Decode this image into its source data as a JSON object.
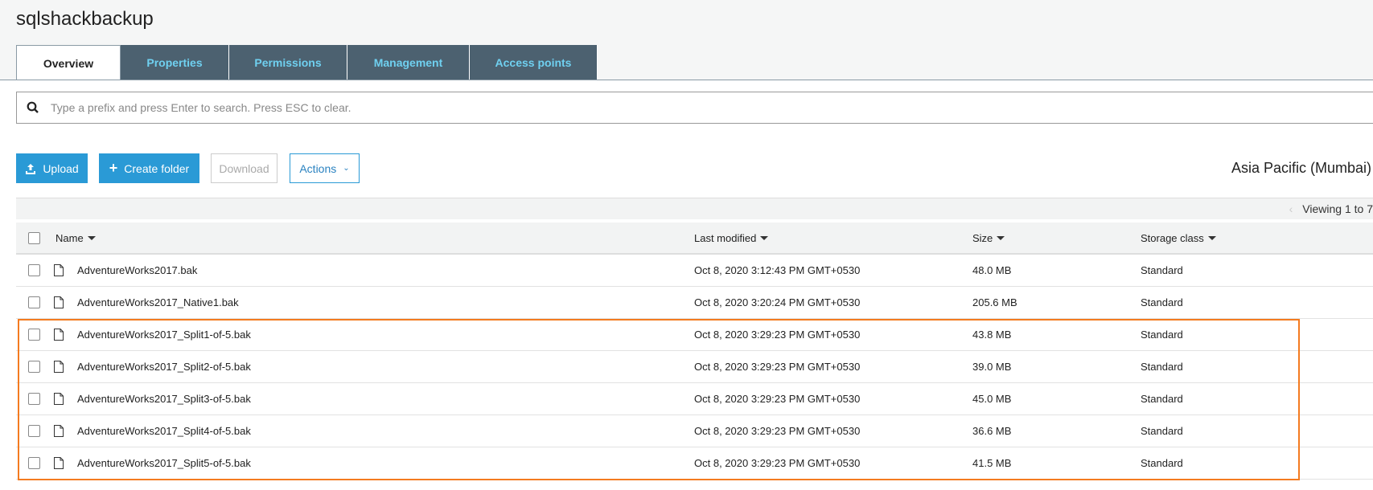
{
  "bucket_title": "sqlshackbackup",
  "tabs": [
    "Overview",
    "Properties",
    "Permissions",
    "Management",
    "Access points"
  ],
  "search": {
    "placeholder": "Type a prefix and press Enter to search. Press ESC to clear."
  },
  "toolbar": {
    "upload": "Upload",
    "create_folder": "Create folder",
    "download": "Download",
    "actions": "Actions"
  },
  "region": "Asia Pacific (Mumbai)",
  "viewing": "Viewing 1 to 7",
  "columns": {
    "name": "Name",
    "last_modified": "Last modified",
    "size": "Size",
    "storage_class": "Storage class"
  },
  "rows": [
    {
      "name": "AdventureWorks2017.bak",
      "modified": "Oct 8, 2020 3:12:43 PM GMT+0530",
      "size": "48.0 MB",
      "storage": "Standard"
    },
    {
      "name": "AdventureWorks2017_Native1.bak",
      "modified": "Oct 8, 2020 3:20:24 PM GMT+0530",
      "size": "205.6 MB",
      "storage": "Standard"
    },
    {
      "name": "AdventureWorks2017_Split1-of-5.bak",
      "modified": "Oct 8, 2020 3:29:23 PM GMT+0530",
      "size": "43.8 MB",
      "storage": "Standard"
    },
    {
      "name": "AdventureWorks2017_Split2-of-5.bak",
      "modified": "Oct 8, 2020 3:29:23 PM GMT+0530",
      "size": "39.0 MB",
      "storage": "Standard"
    },
    {
      "name": "AdventureWorks2017_Split3-of-5.bak",
      "modified": "Oct 8, 2020 3:29:23 PM GMT+0530",
      "size": "45.0 MB",
      "storage": "Standard"
    },
    {
      "name": "AdventureWorks2017_Split4-of-5.bak",
      "modified": "Oct 8, 2020 3:29:23 PM GMT+0530",
      "size": "36.6 MB",
      "storage": "Standard"
    },
    {
      "name": "AdventureWorks2017_Split5-of-5.bak",
      "modified": "Oct 8, 2020 3:29:23 PM GMT+0530",
      "size": "41.5 MB",
      "storage": "Standard"
    }
  ]
}
